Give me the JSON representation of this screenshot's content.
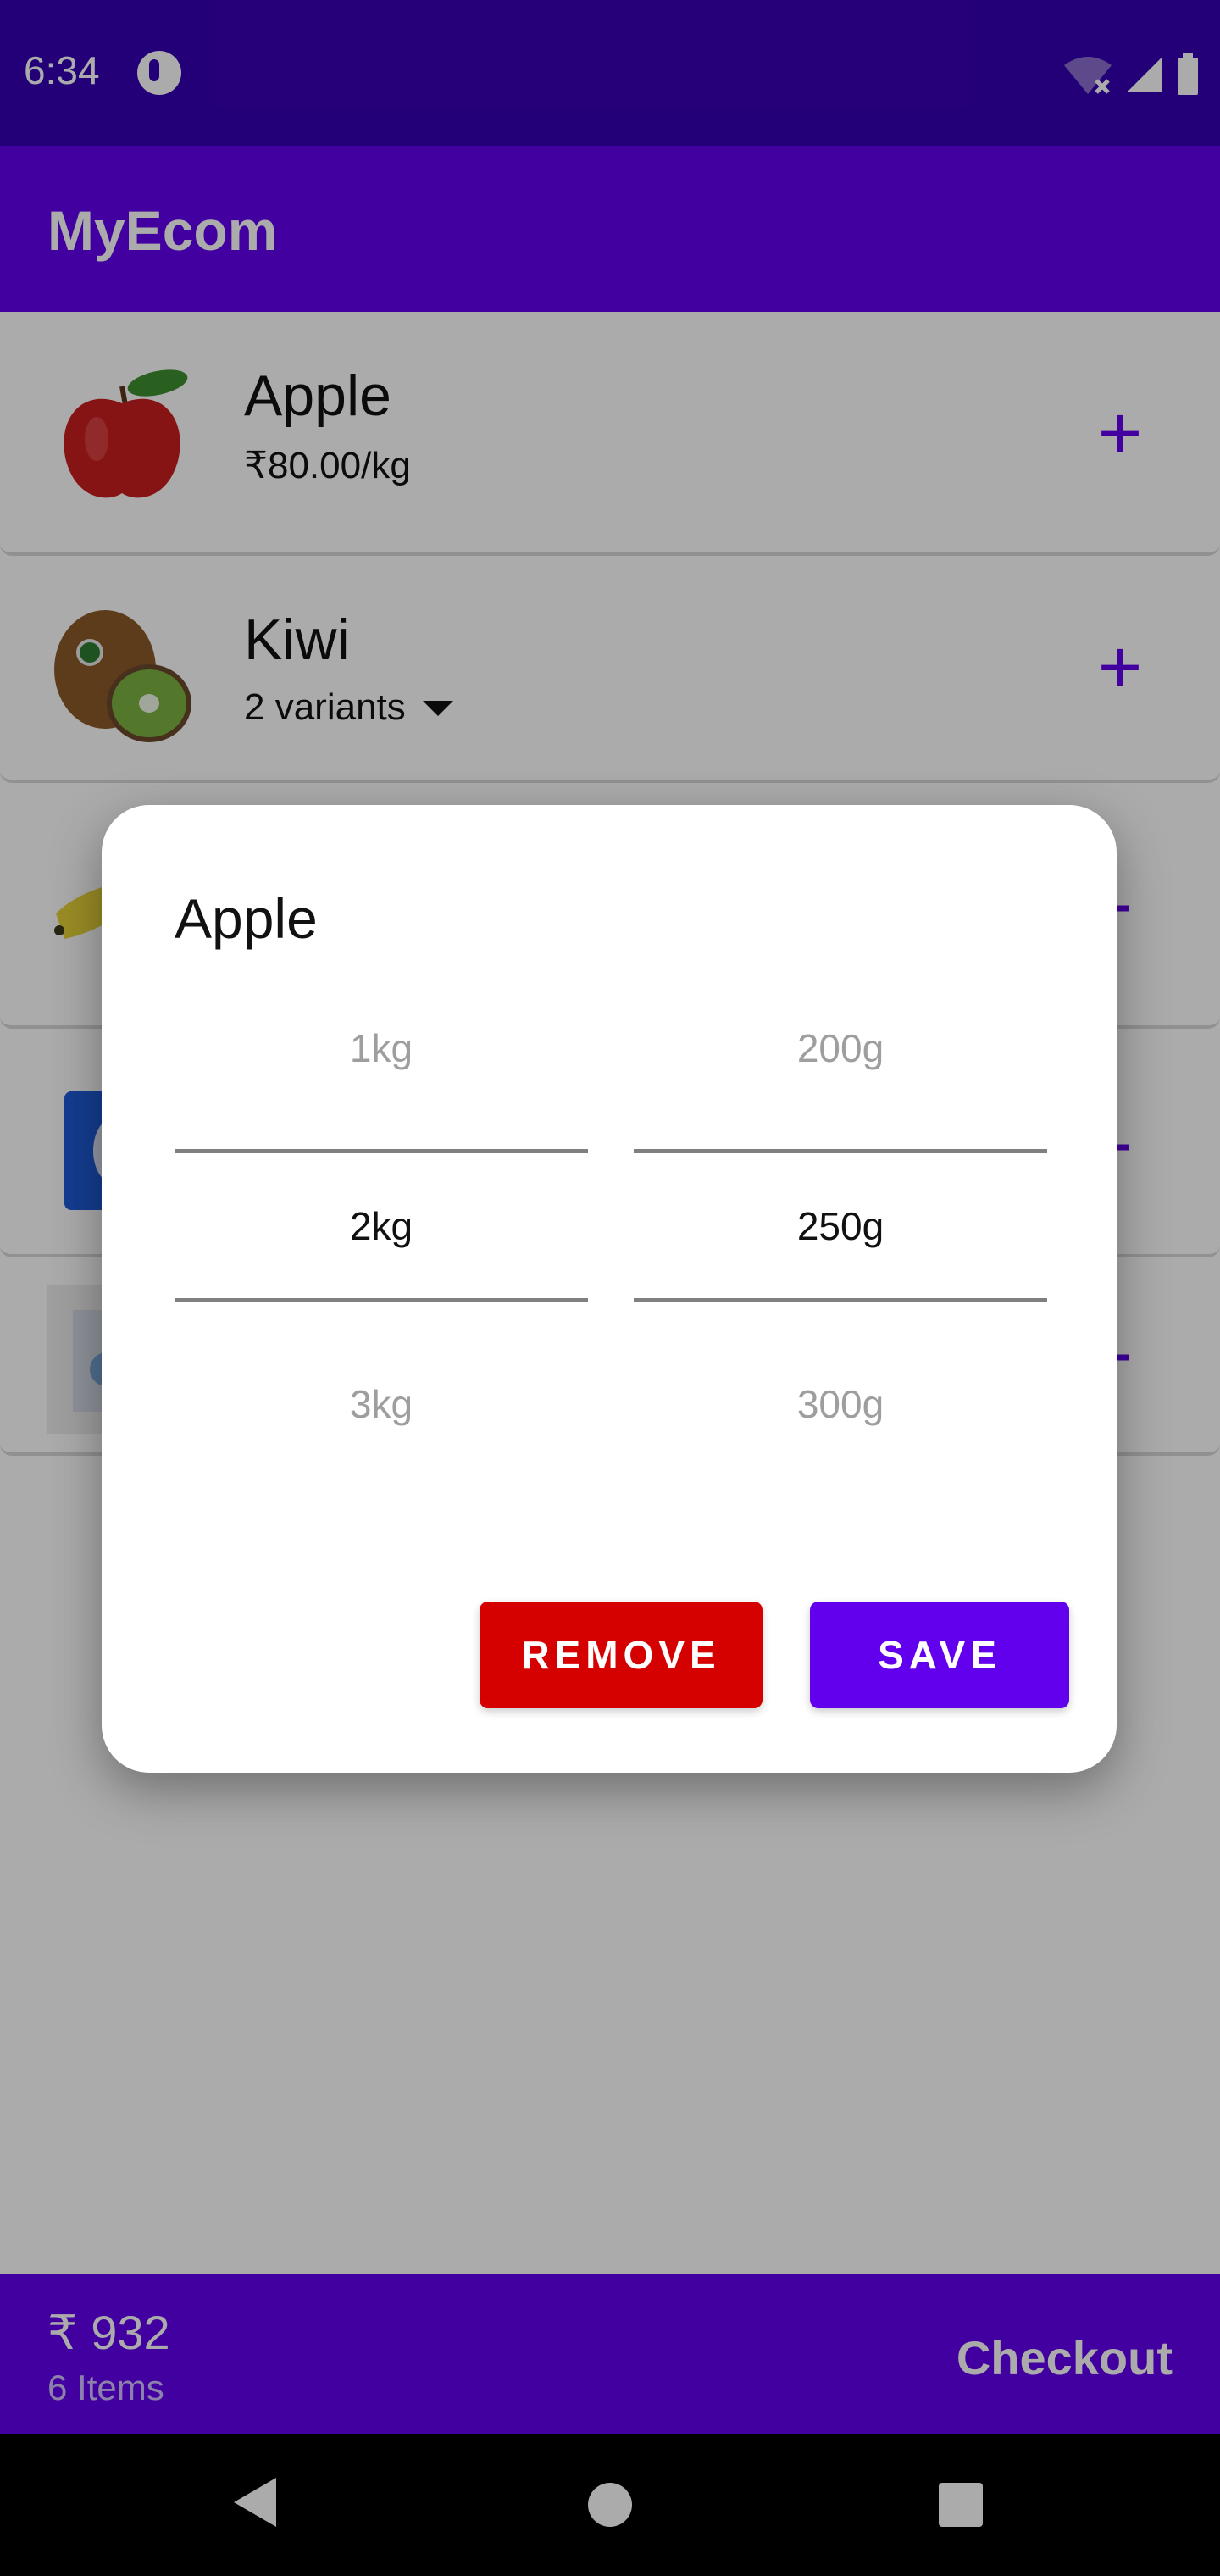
{
  "status_bar": {
    "time": "6:34",
    "icons": [
      "app-notification-icon",
      "wifi-off-icon",
      "signal-icon",
      "battery-icon"
    ]
  },
  "app_bar": {
    "title": "MyEcom"
  },
  "products": [
    {
      "name": "Apple",
      "subtitle": "₹80.00/kg",
      "action": "+"
    },
    {
      "name": "Kiwi",
      "subtitle": "2 variants",
      "action": "+"
    }
  ],
  "hidden_rows_visible_actions": [
    "-",
    "-",
    "-"
  ],
  "bottom_bar": {
    "total": "₹ 932",
    "items": "6 Items",
    "checkout_label": "Checkout"
  },
  "dialog": {
    "title": "Apple",
    "weight_picker": {
      "prev": "1kg",
      "selected": "2kg",
      "next": "3kg"
    },
    "gram_picker": {
      "prev": "200g",
      "selected": "250g",
      "next": "300g"
    },
    "remove_label": "REMOVE",
    "save_label": "SAVE"
  },
  "colors": {
    "primary": "#6200ee",
    "primary_dark": "#3700b3",
    "remove": "#d50000"
  }
}
